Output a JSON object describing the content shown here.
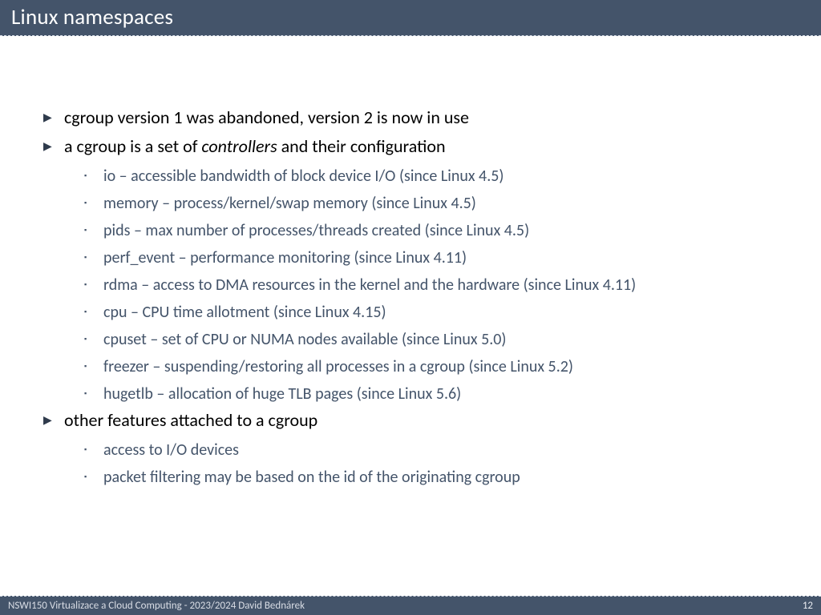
{
  "title": "Linux namespaces",
  "bullets": {
    "b1": "cgroup version 1 was abandoned, version 2 is now in use",
    "b2_pre": "a cgroup is a set of ",
    "b2_em": "controllers",
    "b2_post": " and their configuration",
    "b2_sub": [
      "io – accessible bandwidth of block device I/O (since Linux 4.5)",
      "memory – process/kernel/swap memory (since Linux 4.5)",
      "pids – max number of processes/threads created (since Linux 4.5)",
      "perf_event – performance monitoring (since Linux 4.11)",
      "rdma – access to DMA resources in the kernel and the hardware (since Linux 4.11)",
      "cpu – CPU time allotment (since Linux 4.15)",
      "cpuset – set of CPU or NUMA nodes available (since Linux 5.0)",
      "freezer – suspending/restoring all processes in a cgroup (since Linux 5.2)",
      "hugetlb – allocation of huge TLB pages (since Linux 5.6)"
    ],
    "b3": "other features attached to a cgroup",
    "b3_sub": [
      "access to I/O devices",
      "packet filtering may be based on the id of the originating cgroup"
    ]
  },
  "footer": {
    "left": "NSWI150 Virtualizace a Cloud Computing - 2023/2024 David Bednárek",
    "page": "12"
  }
}
